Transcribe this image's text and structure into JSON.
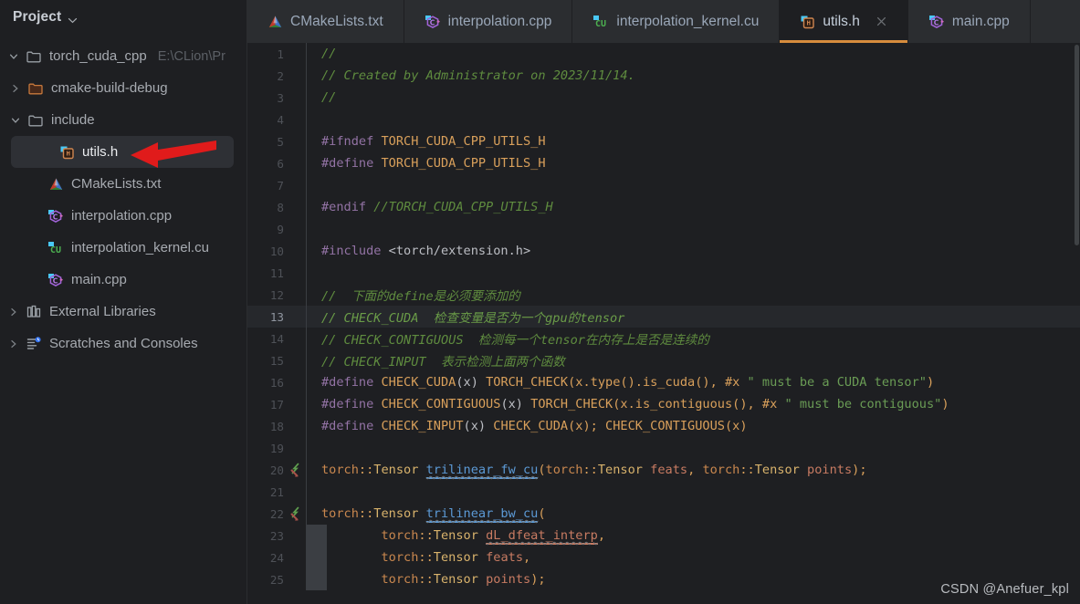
{
  "window": {
    "background": "#1e1f22",
    "accent": "#d78c3d"
  },
  "sidebar": {
    "panel_title": "Project",
    "panel_chevron_icon": "chevron-down-icon",
    "items": [
      {
        "label": "torch_cuda_cpp",
        "path": "E:\\CLion\\Pr",
        "icon": "folder-icon",
        "twisty": "chevron-down-icon",
        "depth": 0,
        "selected": false
      },
      {
        "label": "cmake-build-debug",
        "path": "",
        "icon": "folder-orange-icon",
        "twisty": "chevron-right-icon",
        "depth": 1,
        "selected": false
      },
      {
        "label": "include",
        "path": "",
        "icon": "folder-icon",
        "twisty": "chevron-down-icon",
        "depth": 1,
        "selected": false
      },
      {
        "label": "utils.h",
        "path": "",
        "icon": "header-file-icon",
        "twisty": "",
        "depth": 2,
        "selected": true
      },
      {
        "label": "CMakeLists.txt",
        "path": "",
        "icon": "cmake-icon",
        "twisty": "",
        "depth": 2,
        "selected": false
      },
      {
        "label": "interpolation.cpp",
        "path": "",
        "icon": "cpp-file-icon",
        "twisty": "",
        "depth": 2,
        "selected": false
      },
      {
        "label": "interpolation_kernel.cu",
        "path": "",
        "icon": "cuda-file-icon",
        "twisty": "",
        "depth": 2,
        "selected": false
      },
      {
        "label": "main.cpp",
        "path": "",
        "icon": "cpp-file-icon",
        "twisty": "",
        "depth": 2,
        "selected": false
      },
      {
        "label": "External Libraries",
        "path": "",
        "icon": "library-icon",
        "twisty": "chevron-right-icon",
        "depth": 0,
        "selected": false
      },
      {
        "label": "Scratches and Consoles",
        "path": "",
        "icon": "scratches-icon",
        "twisty": "chevron-right-icon",
        "depth": 0,
        "selected": false
      }
    ]
  },
  "tabs": [
    {
      "label": "CMakeLists.txt",
      "icon": "cmake-icon",
      "active": false,
      "closable": false
    },
    {
      "label": "interpolation.cpp",
      "icon": "cpp-file-icon",
      "active": false,
      "closable": false
    },
    {
      "label": "interpolation_kernel.cu",
      "icon": "cuda-file-icon",
      "active": false,
      "closable": false
    },
    {
      "label": "utils.h",
      "icon": "header-file-icon",
      "active": true,
      "closable": true,
      "close_icon": "close-icon"
    },
    {
      "label": "main.cpp",
      "icon": "cpp-file-icon",
      "active": false,
      "closable": false
    }
  ],
  "editor": {
    "active_file": "utils.h",
    "caret_line": 13,
    "lines": [
      {
        "n": 1,
        "tokens": [
          {
            "t": "//",
            "c": "cm"
          }
        ]
      },
      {
        "n": 2,
        "tokens": [
          {
            "t": "// Created by Administrator on 2023/11/14.",
            "c": "cm"
          }
        ]
      },
      {
        "n": 3,
        "tokens": [
          {
            "t": "//",
            "c": "cm"
          }
        ]
      },
      {
        "n": 4,
        "tokens": []
      },
      {
        "n": 5,
        "tokens": [
          {
            "t": "#ifndef ",
            "c": "pp"
          },
          {
            "t": "TORCH_CUDA_CPP_UTILS_H",
            "c": "mac"
          }
        ]
      },
      {
        "n": 6,
        "tokens": [
          {
            "t": "#define ",
            "c": "pp"
          },
          {
            "t": "TORCH_CUDA_CPP_UTILS_H",
            "c": "mac"
          }
        ]
      },
      {
        "n": 7,
        "tokens": []
      },
      {
        "n": 8,
        "tokens": [
          {
            "t": "#endif ",
            "c": "pp"
          },
          {
            "t": "//TORCH_CUDA_CPP_UTILS_H",
            "c": "cm"
          }
        ]
      },
      {
        "n": 9,
        "tokens": []
      },
      {
        "n": 10,
        "tokens": [
          {
            "t": "#include ",
            "c": "pp"
          },
          {
            "t": "<torch/extension.h>",
            "c": "pun"
          }
        ]
      },
      {
        "n": 11,
        "tokens": []
      },
      {
        "n": 12,
        "tokens": [
          {
            "t": "//  下面的define是必须要添加的",
            "c": "cm"
          }
        ]
      },
      {
        "n": 13,
        "tokens": [
          {
            "t": "// CHECK_CUDA  检查变量是否为一个gpu的tensor",
            "c": "cmh"
          }
        ]
      },
      {
        "n": 14,
        "tokens": [
          {
            "t": "// CHECK_CONTIGUOUS  检测每一个tensor在内存上是否是连续的",
            "c": "cm"
          }
        ]
      },
      {
        "n": 15,
        "tokens": [
          {
            "t": "// CHECK_INPUT  表示检测上面两个函数",
            "c": "cm"
          }
        ]
      },
      {
        "n": 16,
        "tokens": [
          {
            "t": "#define ",
            "c": "pp"
          },
          {
            "t": "CHECK_CUDA",
            "c": "mac"
          },
          {
            "t": "(x)",
            "c": "pun"
          },
          {
            "t": " TORCH_CHECK(x.type().is_cuda(), #x ",
            "c": "mac"
          },
          {
            "t": "\" must be a CUDA tensor\"",
            "c": "str"
          },
          {
            "t": ")",
            "c": "opr"
          }
        ]
      },
      {
        "n": 17,
        "tokens": [
          {
            "t": "#define ",
            "c": "pp"
          },
          {
            "t": "CHECK_CONTIGUOUS",
            "c": "mac"
          },
          {
            "t": "(x)",
            "c": "pun"
          },
          {
            "t": " TORCH_CHECK(x.is_contiguous(), #x ",
            "c": "mac"
          },
          {
            "t": "\" must be contiguous\"",
            "c": "str"
          },
          {
            "t": ")",
            "c": "opr"
          }
        ]
      },
      {
        "n": 18,
        "tokens": [
          {
            "t": "#define ",
            "c": "pp"
          },
          {
            "t": "CHECK_INPUT",
            "c": "mac"
          },
          {
            "t": "(x)",
            "c": "pun"
          },
          {
            "t": " CHECK_CUDA(x); CHECK_CONTIGUOUS(x)",
            "c": "mac"
          }
        ]
      },
      {
        "n": 19,
        "tokens": []
      },
      {
        "n": 20,
        "gutter_icon": "run-gutter-icon",
        "tokens": [
          {
            "t": "torch",
            "c": "kwd"
          },
          {
            "t": "::",
            "c": "opr"
          },
          {
            "t": "Tensor ",
            "c": "typ"
          },
          {
            "t": "trilinear_fw_cu",
            "c": "fn squig"
          },
          {
            "t": "(",
            "c": "opr"
          },
          {
            "t": "torch",
            "c": "kwd"
          },
          {
            "t": "::",
            "c": "opr"
          },
          {
            "t": "Tensor ",
            "c": "typ"
          },
          {
            "t": "feats",
            "c": "prm"
          },
          {
            "t": ", ",
            "c": "opr"
          },
          {
            "t": "torch",
            "c": "kwd"
          },
          {
            "t": "::",
            "c": "opr"
          },
          {
            "t": "Tensor ",
            "c": "typ"
          },
          {
            "t": "points",
            "c": "prm"
          },
          {
            "t": ");",
            "c": "opr"
          }
        ]
      },
      {
        "n": 21,
        "tokens": []
      },
      {
        "n": 22,
        "gutter_icon": "run-gutter-icon",
        "tokens": [
          {
            "t": "torch",
            "c": "kwd"
          },
          {
            "t": "::",
            "c": "opr"
          },
          {
            "t": "Tensor ",
            "c": "typ"
          },
          {
            "t": "trilinear_bw_cu",
            "c": "fn squig"
          },
          {
            "t": "(",
            "c": "opr"
          }
        ]
      },
      {
        "n": 23,
        "indent_guide": true,
        "tokens": [
          {
            "t": "        ",
            "c": "pun"
          },
          {
            "t": "torch",
            "c": "kwd"
          },
          {
            "t": "::",
            "c": "opr"
          },
          {
            "t": "Tensor ",
            "c": "typ"
          },
          {
            "t": "dL_dfeat_interp",
            "c": "prm squig"
          },
          {
            "t": ",",
            "c": "opr"
          }
        ]
      },
      {
        "n": 24,
        "indent_guide": true,
        "tokens": [
          {
            "t": "        ",
            "c": "pun"
          },
          {
            "t": "torch",
            "c": "kwd"
          },
          {
            "t": "::",
            "c": "opr"
          },
          {
            "t": "Tensor ",
            "c": "typ"
          },
          {
            "t": "feats",
            "c": "prm"
          },
          {
            "t": ",",
            "c": "opr"
          }
        ]
      },
      {
        "n": 25,
        "indent_guide": true,
        "tokens": [
          {
            "t": "        ",
            "c": "pun"
          },
          {
            "t": "torch",
            "c": "kwd"
          },
          {
            "t": "::",
            "c": "opr"
          },
          {
            "t": "Tensor ",
            "c": "typ"
          },
          {
            "t": "points",
            "c": "prm"
          },
          {
            "t": ");",
            "c": "opr"
          }
        ]
      }
    ]
  },
  "annotation": {
    "arrow_icon": "red-left-arrow-annotation",
    "color": "#e01b1b",
    "points_at": "utils.h"
  },
  "watermark": {
    "text": "CSDN @Anefuer_kpl"
  }
}
